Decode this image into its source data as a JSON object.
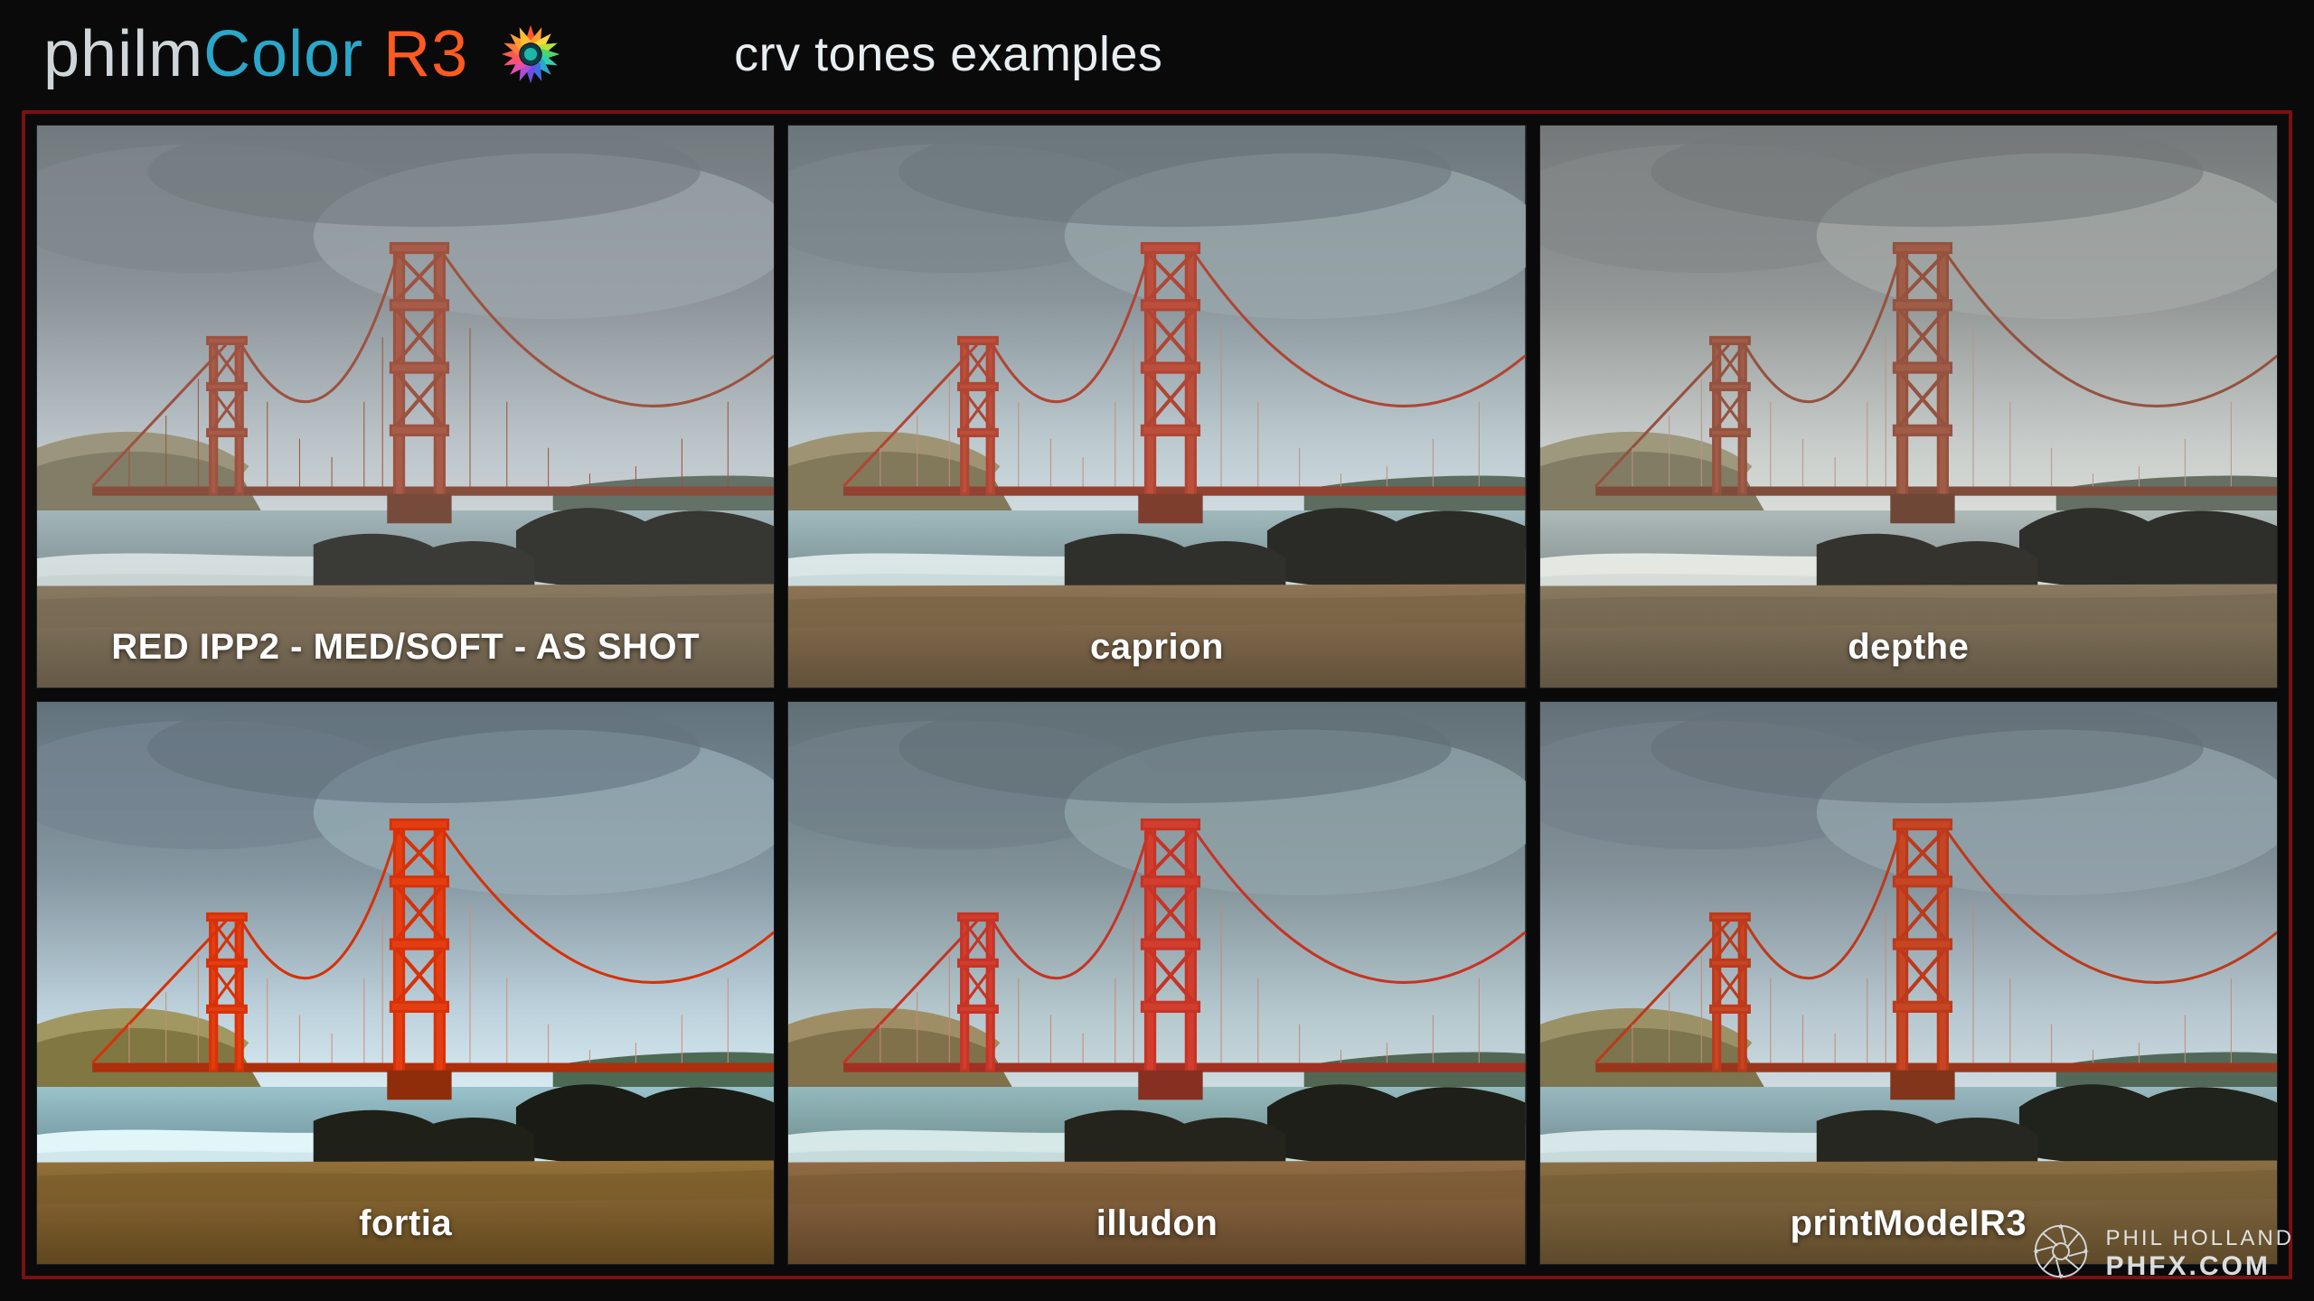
{
  "header": {
    "logo_part1": "philm",
    "logo_part2": "Color",
    "logo_part3": "R3",
    "subtitle": "crv tones examples"
  },
  "cells": [
    {
      "caption": "RED IPP2 - MED/SOFT - AS SHOT"
    },
    {
      "caption": "caprion"
    },
    {
      "caption": "depthe"
    },
    {
      "caption": "fortia"
    },
    {
      "caption": "illudon"
    },
    {
      "caption": "printModelR3"
    }
  ],
  "watermark": {
    "line1": "PHIL HOLLAND",
    "line2": "PHFX.COM"
  },
  "colors": {
    "accent_red": "#ff5a20",
    "accent_teal": "#2aa7c9",
    "frame_border": "#7a1010"
  }
}
